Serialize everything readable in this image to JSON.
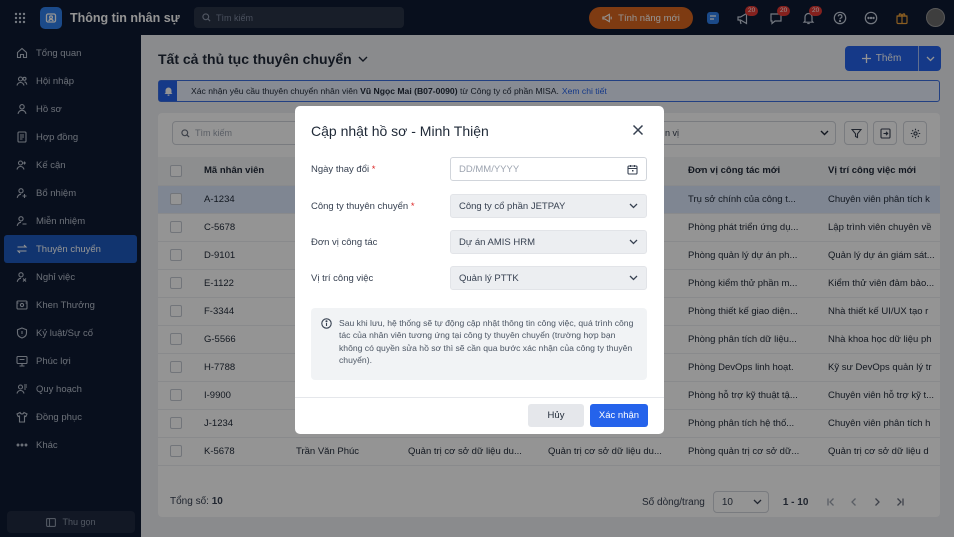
{
  "app": {
    "title": "Thông tin nhân sự",
    "search_placeholder": "Tìm kiếm",
    "new_features_label": "Tính năng mới",
    "badges": [
      "20",
      "20",
      "20"
    ]
  },
  "sidebar": {
    "items": [
      {
        "label": "Tổng quan",
        "icon": "home-icon"
      },
      {
        "label": "Hội nhập",
        "icon": "users-icon"
      },
      {
        "label": "Hồ sơ",
        "icon": "user-icon"
      },
      {
        "label": "Hợp đồng",
        "icon": "document-icon"
      },
      {
        "label": "Kế cận",
        "icon": "user-group-icon"
      },
      {
        "label": "Bổ nhiệm",
        "icon": "user-plus-icon"
      },
      {
        "label": "Miễn nhiệm",
        "icon": "user-minus-icon"
      },
      {
        "label": "Thuyên chuyển",
        "icon": "transfer-icon",
        "active": true
      },
      {
        "label": "Nghỉ việc",
        "icon": "user-off-icon"
      },
      {
        "label": "Khen Thưởng",
        "icon": "award-icon"
      },
      {
        "label": "Kỷ luật/Sự cố",
        "icon": "shield-icon"
      },
      {
        "label": "Phúc lợi",
        "icon": "benefit-icon"
      },
      {
        "label": "Quy hoạch",
        "icon": "planning-icon"
      },
      {
        "label": "Đồng phục",
        "icon": "shirt-icon"
      },
      {
        "label": "Khác",
        "icon": "more-icon"
      }
    ],
    "collapse_label": "Thu gọn"
  },
  "page": {
    "title": "Tất cả thủ tục thuyên chuyển",
    "add_label": "Thêm",
    "notice": {
      "prefix": "Xác nhận yêu cầu thuyên chuyển nhân viên",
      "employee": "Vũ Ngọc Mai (B07-0090)",
      "suffix": "từ Công ty cổ phần MISA.",
      "link": "Xem chi tiết"
    },
    "table_search_placeholder": "Tìm kiếm",
    "filter_value": "n vị"
  },
  "table": {
    "columns": [
      "Mã nhân viên",
      "",
      "",
      "",
      "Đơn vị công tác mới",
      "Vị trí công việc mới"
    ],
    "rows": [
      [
        "A-1234",
        "",
        "",
        "",
        "Trụ sở chính của công t...",
        "Chuyên viên phân tích k"
      ],
      [
        "C-5678",
        "",
        "",
        "",
        "Phòng phát triển ứng dụ...",
        "Lập trình viên chuyên về"
      ],
      [
        "D-9101",
        "",
        "",
        "",
        "Phòng quản lý dự án ph...",
        "Quản lý dự án giám sát..."
      ],
      [
        "E-1122",
        "",
        "",
        "",
        "Phòng kiểm thử phần m...",
        "Kiểm thử viên đảm bảo..."
      ],
      [
        "F-3344",
        "",
        "",
        "",
        "Phòng thiết kế giao diện...",
        "Nhà thiết kế UI/UX tạo r"
      ],
      [
        "G-5566",
        "",
        "",
        "",
        "Phòng phân tích dữ liệu...",
        "Nhà khoa học dữ liệu ph"
      ],
      [
        "H-7788",
        "",
        "",
        "",
        "Phòng DevOps linh hoạt.",
        "Kỹ sư DevOps quản lý tr"
      ],
      [
        "I-9900",
        "",
        "",
        "",
        "Phòng hỗ trợ kỹ thuật tậ...",
        "Chuyên viên hỗ trợ kỹ t..."
      ],
      [
        "J-1234",
        "",
        "",
        "",
        "Phòng phân tích hệ thố...",
        "Chuyên viên phân tích h"
      ],
      [
        "K-5678",
        "Trần Văn Phúc",
        "Quản trị cơ sở dữ liệu du...",
        "Quản trị cơ sở dữ liệu du...",
        "Phòng quản trị cơ sở dữ...",
        "Quản trị cơ sở dữ liệu d"
      ]
    ],
    "total_label": "Tổng số:",
    "total": "10",
    "rows_per_page_label": "Số dòng/trang",
    "rows_per_page": "10",
    "range": "1 - 10"
  },
  "modal": {
    "title": "Cập nhật hồ sơ - Minh Thiện",
    "fields": [
      {
        "label": "Ngày thay đổi",
        "required": true,
        "placeholder": "DD/MM/YYYY",
        "value": ""
      },
      {
        "label": "Công ty thuyên chuyển",
        "required": true,
        "value": "Công ty cổ phần JETPAY"
      },
      {
        "label": "Đơn vị công tác",
        "required": false,
        "value": "Dự án AMIS HRM"
      },
      {
        "label": "Vị trí công việc",
        "required": false,
        "value": "Quản lý PTTK"
      }
    ],
    "required_mark": "*",
    "info": "Sau khi lưu, hệ thống sẽ tự động cập nhật thông tin công việc, quá trình công tác của nhân viên tương ứng tại công ty thuyên chuyển (trường hợp bạn không có quyền sửa hồ sơ thì sẽ cần qua bước xác nhận của công ty thuyên chuyển).",
    "cancel_label": "Hủy",
    "confirm_label": "Xác nhận"
  },
  "colors": {
    "primary": "#2563eb",
    "sidebar_bg": "#0f1b33",
    "active_item": "#1e5bbf",
    "feature_btn": "#d9661f",
    "badge": "#e53935"
  }
}
